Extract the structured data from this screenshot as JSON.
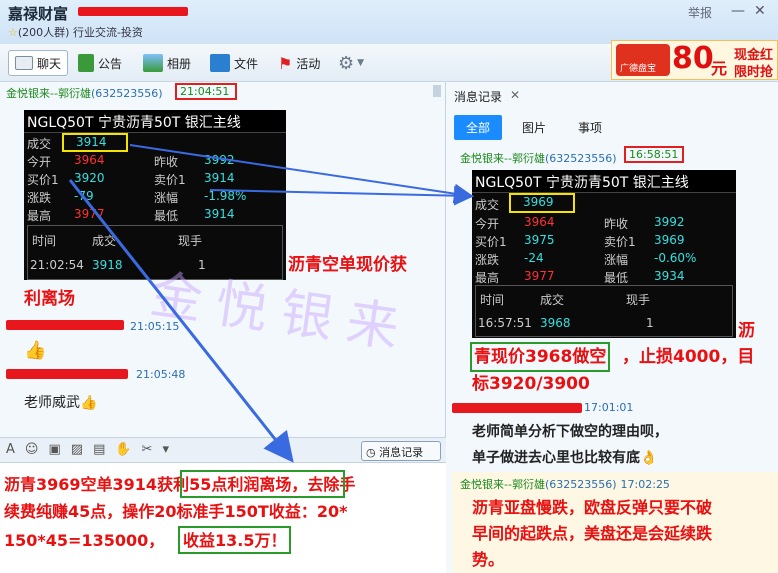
{
  "window": {
    "title": "嘉禄财富",
    "subtitle": "(200人群) 行业交流-投资",
    "report_label": "举报"
  },
  "toolbar": {
    "items": [
      {
        "label": "聊天"
      },
      {
        "label": "公告"
      },
      {
        "label": "相册"
      },
      {
        "label": "文件"
      },
      {
        "label": "活动"
      }
    ]
  },
  "ad": {
    "badge": "广德盘宝",
    "amount": "80",
    "unit": "元",
    "line1": "现金红",
    "line2": "限时抢"
  },
  "chat": {
    "msg1": {
      "sender": "金悦银来--郭衍雄",
      "uid": "(632523556)",
      "time": "21:04:51",
      "caption_line1": "沥青空单现价获",
      "caption_line2": "利离场"
    },
    "quote1": {
      "header": "NGLQ50T  宁贵沥青50T  银汇主线",
      "rows": [
        {
          "l1": "成交",
          "v1": "3914",
          "l2": "",
          "v2": ""
        },
        {
          "l1": "今开",
          "v1": "3964",
          "l2": "昨收",
          "v2": "3992"
        },
        {
          "l1": "买价1",
          "v1": "3920",
          "l2": "卖价1",
          "v2": "3914"
        },
        {
          "l1": "涨跌",
          "v1": "-79",
          "l2": "涨幅",
          "v2": "-1.98%"
        },
        {
          "l1": "最高",
          "v1": "3977",
          "l2": "最低",
          "v2": "3914"
        }
      ],
      "tick_headers": [
        "时间",
        "成交",
        "现手"
      ],
      "tick": {
        "time": "21:02:54",
        "price": "3918",
        "qty": "1"
      }
    },
    "msg2": {
      "time": "21:05:15",
      "emoji": "👍"
    },
    "msg3": {
      "time": "21:05:48",
      "text": "老师威武👍"
    },
    "input_toolbar": {
      "history_label": "消息记录"
    },
    "input_text": {
      "line1": "沥青3969空单3914获利55点利润离场，去除手",
      "line2": "续费纯赚45点，操作20标准手150T收益：20*",
      "line3_a": "150*45=135000，",
      "line3_b": "收益13.5万！"
    }
  },
  "history": {
    "title": "消息记录",
    "tabs": [
      {
        "label": "全部"
      },
      {
        "label": "图片"
      },
      {
        "label": "事项"
      }
    ],
    "msg1": {
      "sender": "金悦银来--郭衍雄",
      "uid": "(632523556)",
      "time": "16:58:51",
      "caption_1": "沥",
      "caption_2a": "青现价3968做空",
      "caption_2b": "，止损4000，目",
      "caption_3": "标3920/3900"
    },
    "quote2": {
      "header": "NGLQ50T  宁贵沥青50T  银汇主线",
      "rows": [
        {
          "l1": "成交",
          "v1": "3969",
          "l2": "",
          "v2": ""
        },
        {
          "l1": "今开",
          "v1": "3964",
          "l2": "昨收",
          "v2": "3992"
        },
        {
          "l1": "买价1",
          "v1": "3975",
          "l2": "卖价1",
          "v2": "3969"
        },
        {
          "l1": "涨跌",
          "v1": "-24",
          "l2": "涨幅",
          "v2": "-0.60%"
        },
        {
          "l1": "最高",
          "v1": "3977",
          "l2": "最低",
          "v2": "3934"
        }
      ],
      "tick_headers": [
        "时间",
        "成交",
        "现手"
      ],
      "tick": {
        "time": "16:57:51",
        "price": "3968",
        "qty": "1"
      }
    },
    "msg2": {
      "time": "17:01:01",
      "line1": "老师简单分析下做空的理由呗，",
      "line2": "单子做进去心里也比较有底👌"
    },
    "msg3": {
      "sender": "金悦银来--郭衍雄",
      "uid": "(632523556)",
      "time": "17:02:25",
      "line1": "沥青亚盘慢跌，欧盘反弹只要不破",
      "line2": "早间的起跌点，美盘还是会延续跌",
      "line3": "势。"
    }
  },
  "watermark": "金悦银来"
}
